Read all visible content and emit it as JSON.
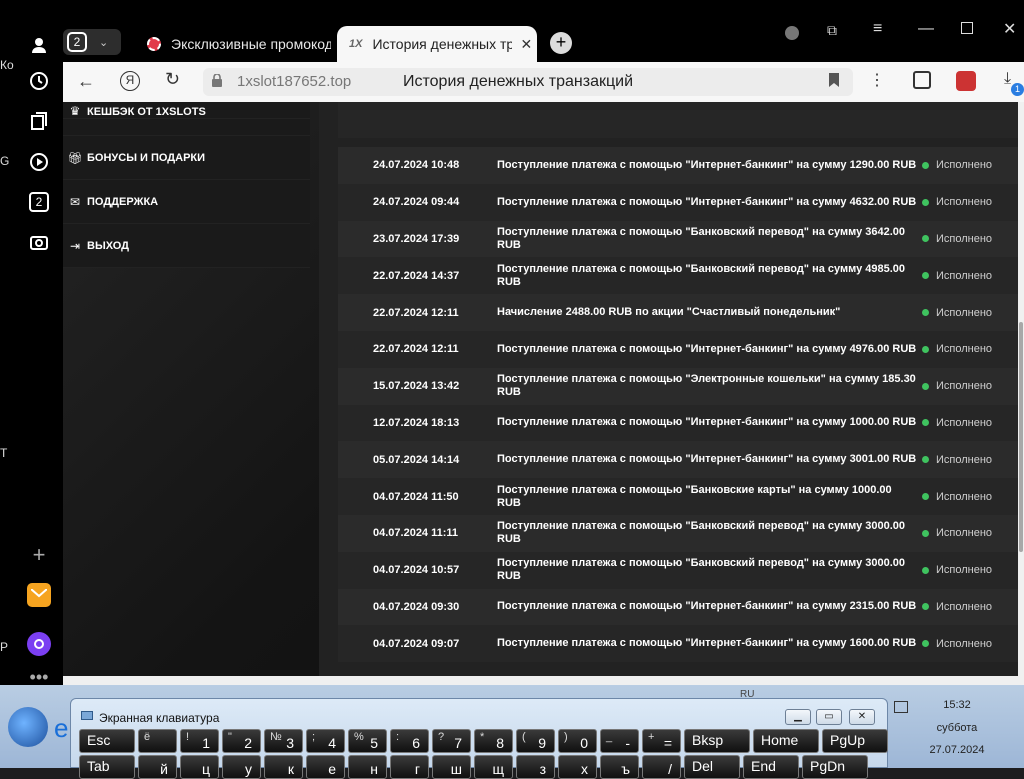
{
  "browser": {
    "tab_count": "2",
    "tabs": [
      {
        "title": "Эксклюзивные промокод",
        "favicon": "casino-chip-icon"
      },
      {
        "title": "История денежных тра",
        "favicon": "1x-logo-icon"
      }
    ],
    "address": "1xslot187652.top",
    "page_title": "История денежных транзакций",
    "downloads_badge": "1",
    "sidebar_badge": "2",
    "left_edge_texts": [
      "Ко",
      "G",
      "T",
      "P"
    ]
  },
  "menu": [
    {
      "label": "КЕШБЭК ОТ 1XSLOTS",
      "icon": "crown-icon"
    },
    {
      "label": "БОНУСЫ И ПОДАРКИ",
      "icon": "gift-icon"
    },
    {
      "label": "ПОДДЕРЖКА",
      "icon": "envelope-icon"
    },
    {
      "label": "ВЫХОД",
      "icon": "logout-icon"
    }
  ],
  "transactions": [
    {
      "date": "24.07.2024 10:48",
      "desc": "Поступление платежа с помощью \"Интернет-банкинг\" на сумму 1290.00 RUB",
      "status": "Исполнено"
    },
    {
      "date": "24.07.2024 09:44",
      "desc": "Поступление платежа с помощью \"Интернет-банкинг\" на сумму 4632.00 RUB",
      "status": "Исполнено"
    },
    {
      "date": "23.07.2024 17:39",
      "desc": "Поступление платежа с помощью \"Банковский перевод\" на сумму 3642.00 RUB",
      "status": "Исполнено"
    },
    {
      "date": "22.07.2024 14:37",
      "desc": "Поступление платежа с помощью \"Банковский перевод\" на сумму 4985.00 RUB",
      "status": "Исполнено"
    },
    {
      "date": "22.07.2024 12:11",
      "desc": "Начисление 2488.00 RUB по акции \"Счастливый понедельник\"",
      "status": "Исполнено"
    },
    {
      "date": "22.07.2024 12:11",
      "desc": "Поступление платежа с помощью \"Интернет-банкинг\" на сумму 4976.00 RUB",
      "status": "Исполнено"
    },
    {
      "date": "15.07.2024 13:42",
      "desc": "Поступление платежа с помощью \"Электронные кошельки\" на сумму 185.30 RUB",
      "status": "Исполнено"
    },
    {
      "date": "12.07.2024 18:13",
      "desc": "Поступление платежа с помощью \"Интернет-банкинг\" на сумму 1000.00 RUB",
      "status": "Исполнено"
    },
    {
      "date": "05.07.2024 14:14",
      "desc": "Поступление платежа с помощью \"Интернет-банкинг\" на сумму 3001.00 RUB",
      "status": "Исполнено"
    },
    {
      "date": "04.07.2024 11:50",
      "desc": "Поступление платежа с помощью \"Банковские карты\" на сумму 1000.00 RUB",
      "status": "Исполнено"
    },
    {
      "date": "04.07.2024 11:11",
      "desc": "Поступление платежа с помощью \"Банковский перевод\" на сумму 3000.00 RUB",
      "status": "Исполнено"
    },
    {
      "date": "04.07.2024 10:57",
      "desc": "Поступление платежа с помощью \"Банковский перевод\" на сумму 3000.00 RUB",
      "status": "Исполнено"
    },
    {
      "date": "04.07.2024 09:30",
      "desc": "Поступление платежа с помощью \"Интернет-банкинг\" на сумму 2315.00 RUB",
      "status": "Исполнено"
    },
    {
      "date": "04.07.2024 09:07",
      "desc": "Поступление платежа с помощью \"Интернет-банкинг\" на сумму 1600.00 RUB",
      "status": "Исполнено"
    }
  ],
  "status_color": "#3fc35f",
  "osk": {
    "title": "Экранная клавиатура",
    "row1": [
      {
        "main": "Esc",
        "top": ""
      },
      {
        "main": "",
        "top": "ё"
      },
      {
        "main": "1",
        "top": "!"
      },
      {
        "main": "2",
        "top": "\""
      },
      {
        "main": "3",
        "top": "№"
      },
      {
        "main": "4",
        "top": ";"
      },
      {
        "main": "5",
        "top": "%"
      },
      {
        "main": "6",
        "top": ":"
      },
      {
        "main": "7",
        "top": "?"
      },
      {
        "main": "8",
        "top": "*"
      },
      {
        "main": "9",
        "top": "("
      },
      {
        "main": "0",
        "top": ")"
      },
      {
        "main": "-",
        "top": "_"
      },
      {
        "main": "=",
        "top": "+"
      },
      {
        "main": "Bksp",
        "top": ""
      },
      {
        "main": "Home",
        "top": ""
      },
      {
        "main": "PgUp",
        "top": ""
      }
    ],
    "row2": [
      {
        "main": "Tab"
      },
      {
        "main": "й"
      },
      {
        "main": "ц"
      },
      {
        "main": "у"
      },
      {
        "main": "к"
      },
      {
        "main": "е"
      },
      {
        "main": "н"
      },
      {
        "main": "г"
      },
      {
        "main": "ш"
      },
      {
        "main": "щ"
      },
      {
        "main": "з"
      },
      {
        "main": "х"
      },
      {
        "main": "ъ"
      },
      {
        "main": "/"
      },
      {
        "main": "Del"
      },
      {
        "main": "End"
      },
      {
        "main": "PgDn"
      }
    ]
  },
  "taskbar": {
    "lang": "RU",
    "time": "15:32",
    "day": "суббота",
    "date": "27.07.2024"
  }
}
